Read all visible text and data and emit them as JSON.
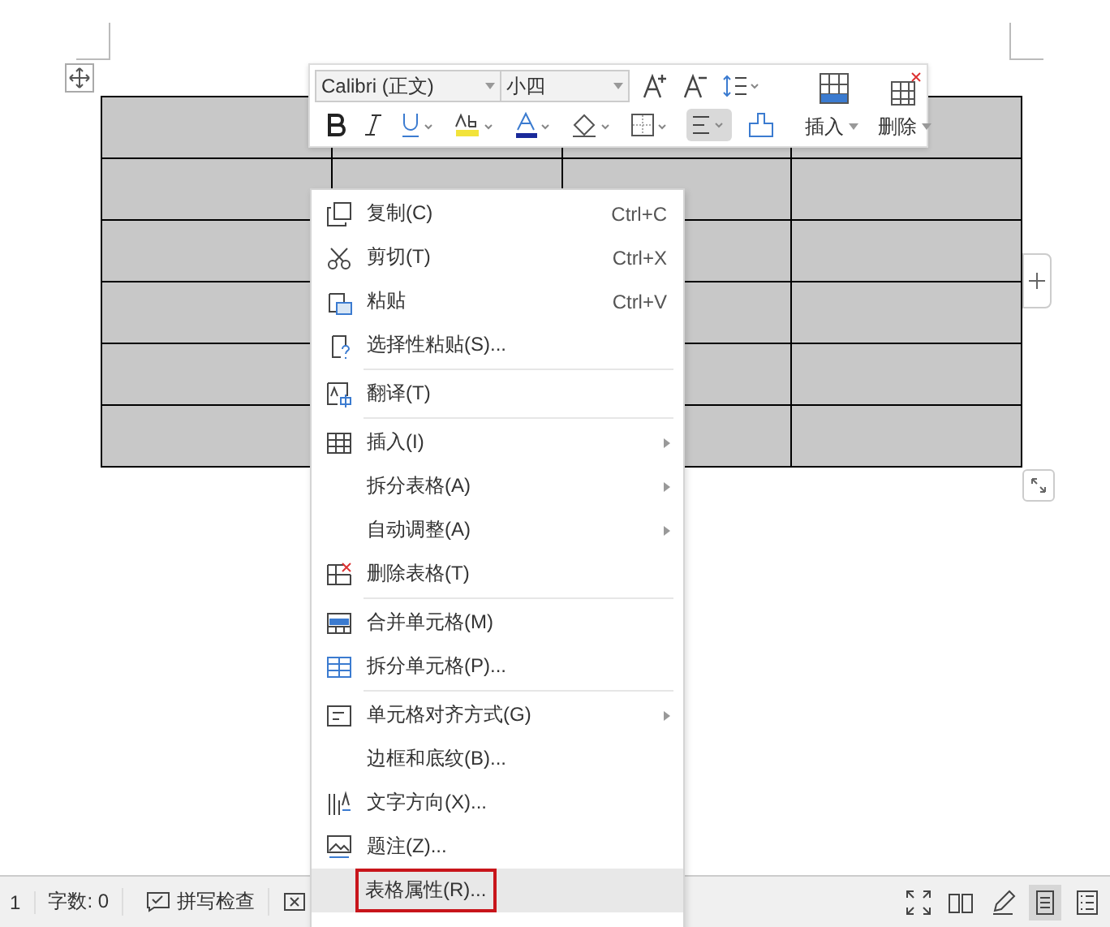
{
  "toolbar": {
    "font": "Calibri (正文)",
    "size": "小四",
    "align_selected": true,
    "insert_label": "插入",
    "delete_label": "删除"
  },
  "menu": {
    "groups": [
      [
        {
          "label": "复制(C)",
          "shortcut": "Ctrl+C",
          "submenu": false,
          "selected": false
        },
        {
          "label": "剪切(T)",
          "shortcut": "Ctrl+X",
          "submenu": false,
          "selected": false
        },
        {
          "label": "粘贴",
          "shortcut": "Ctrl+V",
          "submenu": false,
          "selected": false
        },
        {
          "label": "选择性粘贴(S)...",
          "submenu": false,
          "selected": false
        }
      ],
      [
        {
          "label": "翻译(T)",
          "submenu": false,
          "selected": false
        }
      ],
      [
        {
          "label": "插入(I)",
          "submenu": true,
          "selected": false
        },
        {
          "label": "拆分表格(A)",
          "submenu": true,
          "selected": false
        },
        {
          "label": "自动调整(A)",
          "submenu": true,
          "selected": false
        },
        {
          "label": "删除表格(T)",
          "submenu": false,
          "selected": false
        }
      ],
      [
        {
          "label": "合并单元格(M)",
          "submenu": false,
          "selected": false
        },
        {
          "label": "拆分单元格(P)...",
          "submenu": false,
          "selected": false
        }
      ],
      [
        {
          "label": "单元格对齐方式(G)",
          "submenu": true,
          "selected": false
        },
        {
          "label": "边框和底纹(B)...",
          "submenu": false,
          "selected": false
        },
        {
          "label": "文字方向(X)...",
          "submenu": false,
          "selected": false
        },
        {
          "label": "题注(Z)...",
          "submenu": false,
          "selected": false
        },
        {
          "label": "表格属性(R)...",
          "submenu": false,
          "selected": true,
          "outlined": true
        }
      ]
    ]
  },
  "status_bar": {
    "page": "1",
    "word_count": "字数: 0",
    "spell_check": "拼写检查",
    "views": [
      {
        "selected": false
      },
      {
        "selected": false
      },
      {
        "selected": false
      },
      {
        "selected": true
      },
      {
        "selected": false
      }
    ]
  }
}
